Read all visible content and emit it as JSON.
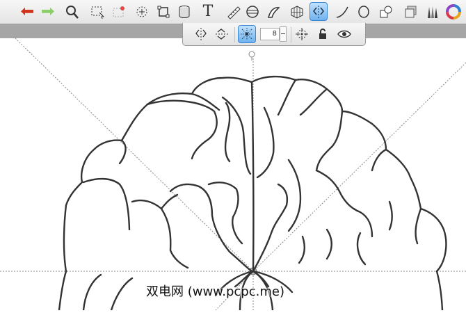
{
  "toolbar": {
    "tools": [
      {
        "name": "undo-icon"
      },
      {
        "name": "redo-icon"
      },
      {
        "name": "magnifier-icon"
      },
      {
        "name": "rect-select-icon"
      },
      {
        "name": "lasso-select-icon"
      },
      {
        "name": "transform-icon"
      },
      {
        "name": "crop-icon"
      },
      {
        "name": "layer-cylinder-icon"
      },
      {
        "name": "text-icon"
      },
      {
        "name": "ruler-icon"
      },
      {
        "name": "ellipse-guide-icon"
      },
      {
        "name": "french-curve-icon"
      },
      {
        "name": "perspective-grid-icon"
      },
      {
        "name": "symmetry-icon"
      },
      {
        "name": "stroke-icon"
      },
      {
        "name": "ellipse-icon"
      },
      {
        "name": "shapes-icon"
      },
      {
        "name": "layers-icon"
      },
      {
        "name": "brush-library-icon"
      },
      {
        "name": "color-wheel-icon"
      }
    ],
    "text_tool_glyph": "T",
    "colors": {
      "undo": "#d4341f",
      "redo": "#8ccf6c",
      "accent": "#6fb2ef"
    }
  },
  "symmetry_bar": {
    "rotary_count": "8"
  },
  "watermark": "双电网 (www.pcpc.me)"
}
